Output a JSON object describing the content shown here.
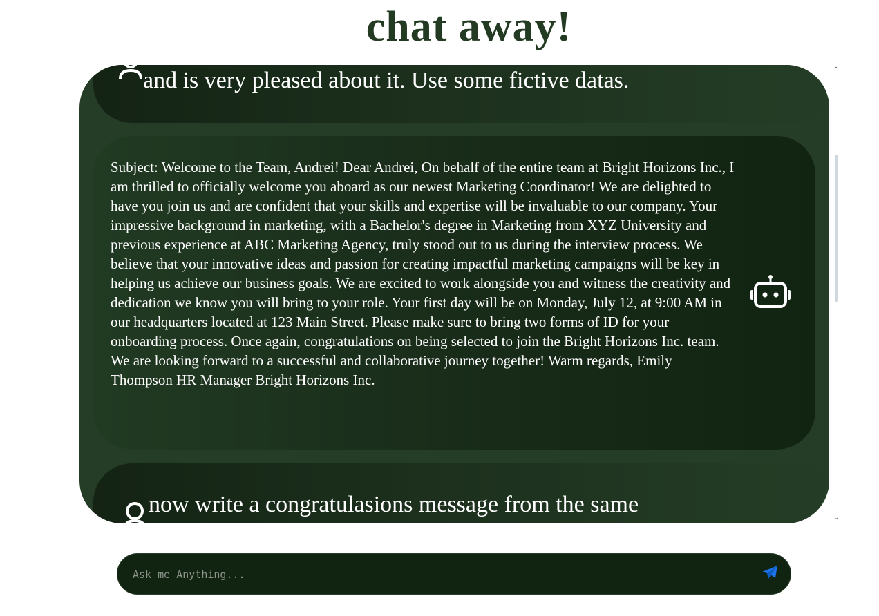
{
  "header": {
    "title": "chat away!"
  },
  "messages": [
    {
      "role": "user",
      "text": "and is very pleased about it. Use some fictive datas."
    },
    {
      "role": "bot",
      "text": "Subject: Welcome to the Team, Andrei! Dear Andrei, On behalf of the entire team at Bright Horizons Inc., I am thrilled to officially welcome you aboard as our newest Marketing Coordinator! We are delighted to have you join us and are confident that your skills and expertise will be invaluable to our company. Your impressive background in marketing, with a Bachelor's degree in Marketing from XYZ University and previous experience at ABC Marketing Agency, truly stood out to us during the interview process. We believe that your innovative ideas and passion for creating impactful marketing campaigns will be key in helping us achieve our business goals. We are excited to work alongside you and witness the creativity and dedication we know you will bring to your role. Your first day will be on Monday, July 12, at 9:00 AM in our headquarters located at 123 Main Street. Please make sure to bring two forms of ID for your onboarding process. Once again, congratulations on being selected to join the Bright Horizons Inc. team. We are looking forward to a successful and collaborative journey together! Warm regards, Emily Thompson HR Manager Bright Horizons Inc."
    },
    {
      "role": "user",
      "text": "now write a congratulasions message from the same"
    }
  ],
  "icons": {
    "user": "user-icon",
    "bot": "robot-icon",
    "send": "paper-plane-icon",
    "scroll_up": "chevron-up-icon",
    "scroll_down": "chevron-down-icon"
  },
  "input": {
    "placeholder": "Ask me Anything...",
    "value": ""
  },
  "colors": {
    "title": "#233a23",
    "panel": "#253d26",
    "bubble_dark": "#112311",
    "send_icon": "#1a73e8"
  }
}
